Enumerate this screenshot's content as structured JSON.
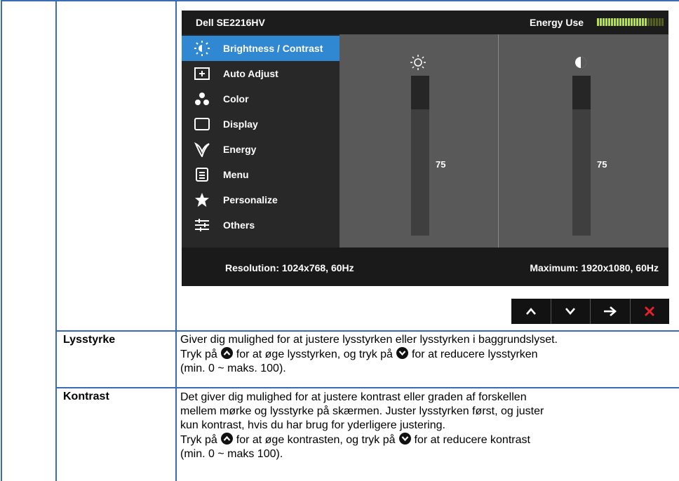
{
  "osd": {
    "model": "Dell SE2216HV",
    "energy_label": "Energy Use",
    "energy_level": 0.75,
    "menu": [
      {
        "label": "Brightness / Contrast",
        "icon": "brightness-icon",
        "active": true
      },
      {
        "label": "Auto Adjust",
        "icon": "auto-adjust-icon",
        "active": false
      },
      {
        "label": "Color",
        "icon": "color-icon",
        "active": false
      },
      {
        "label": "Display",
        "icon": "display-icon",
        "active": false
      },
      {
        "label": "Energy",
        "icon": "energy-icon",
        "active": false
      },
      {
        "label": "Menu",
        "icon": "menu-icon",
        "active": false
      },
      {
        "label": "Personalize",
        "icon": "star-icon",
        "active": false
      },
      {
        "label": "Others",
        "icon": "sliders-icon",
        "active": false
      }
    ],
    "brightness": {
      "value": "75",
      "level": 0.75,
      "icon": "sun-icon"
    },
    "contrast": {
      "value": "75",
      "level": 0.75,
      "icon": "contrast-icon"
    },
    "resolution": "Resolution: 1024x768, 60Hz",
    "maximum": "Maximum: 1920x1080, 60Hz",
    "accent_color": "#2f88d1"
  },
  "buttons": [
    {
      "icon": "up-arrow-icon"
    },
    {
      "icon": "down-arrow-icon"
    },
    {
      "icon": "right-arrow-icon"
    },
    {
      "icon": "close-icon"
    }
  ],
  "rows": [
    {
      "term": "Lysstyrke",
      "lines": [
        {
          "text": "Giver dig mulighed for at justere lysstyrken eller lysstyrken i baggrundslyset."
        },
        {
          "a": "Tryk på",
          "b": "for at øge lysstyrken, og tryk på",
          "c": "for at reducere lysstyrken"
        },
        {
          "text": "(min. 0 ~ maks. 100)."
        }
      ]
    },
    {
      "term": "Kontrast",
      "lines": [
        {
          "text": "Det giver dig mulighed for at justere kontrast eller graden af forskellen"
        },
        {
          "text": "mellem mørke og lysstyrke på skærmen. Juster lysstyrken først, og juster"
        },
        {
          "text": "kun kontrast, hvis du har brug for yderligere justering."
        },
        {
          "a": "Tryk på",
          "b": "for at øge kontrasten, og tryk på",
          "c": "for at reducere kontrast"
        },
        {
          "text": "(min. 0 ~ maks 100)."
        }
      ]
    }
  ]
}
